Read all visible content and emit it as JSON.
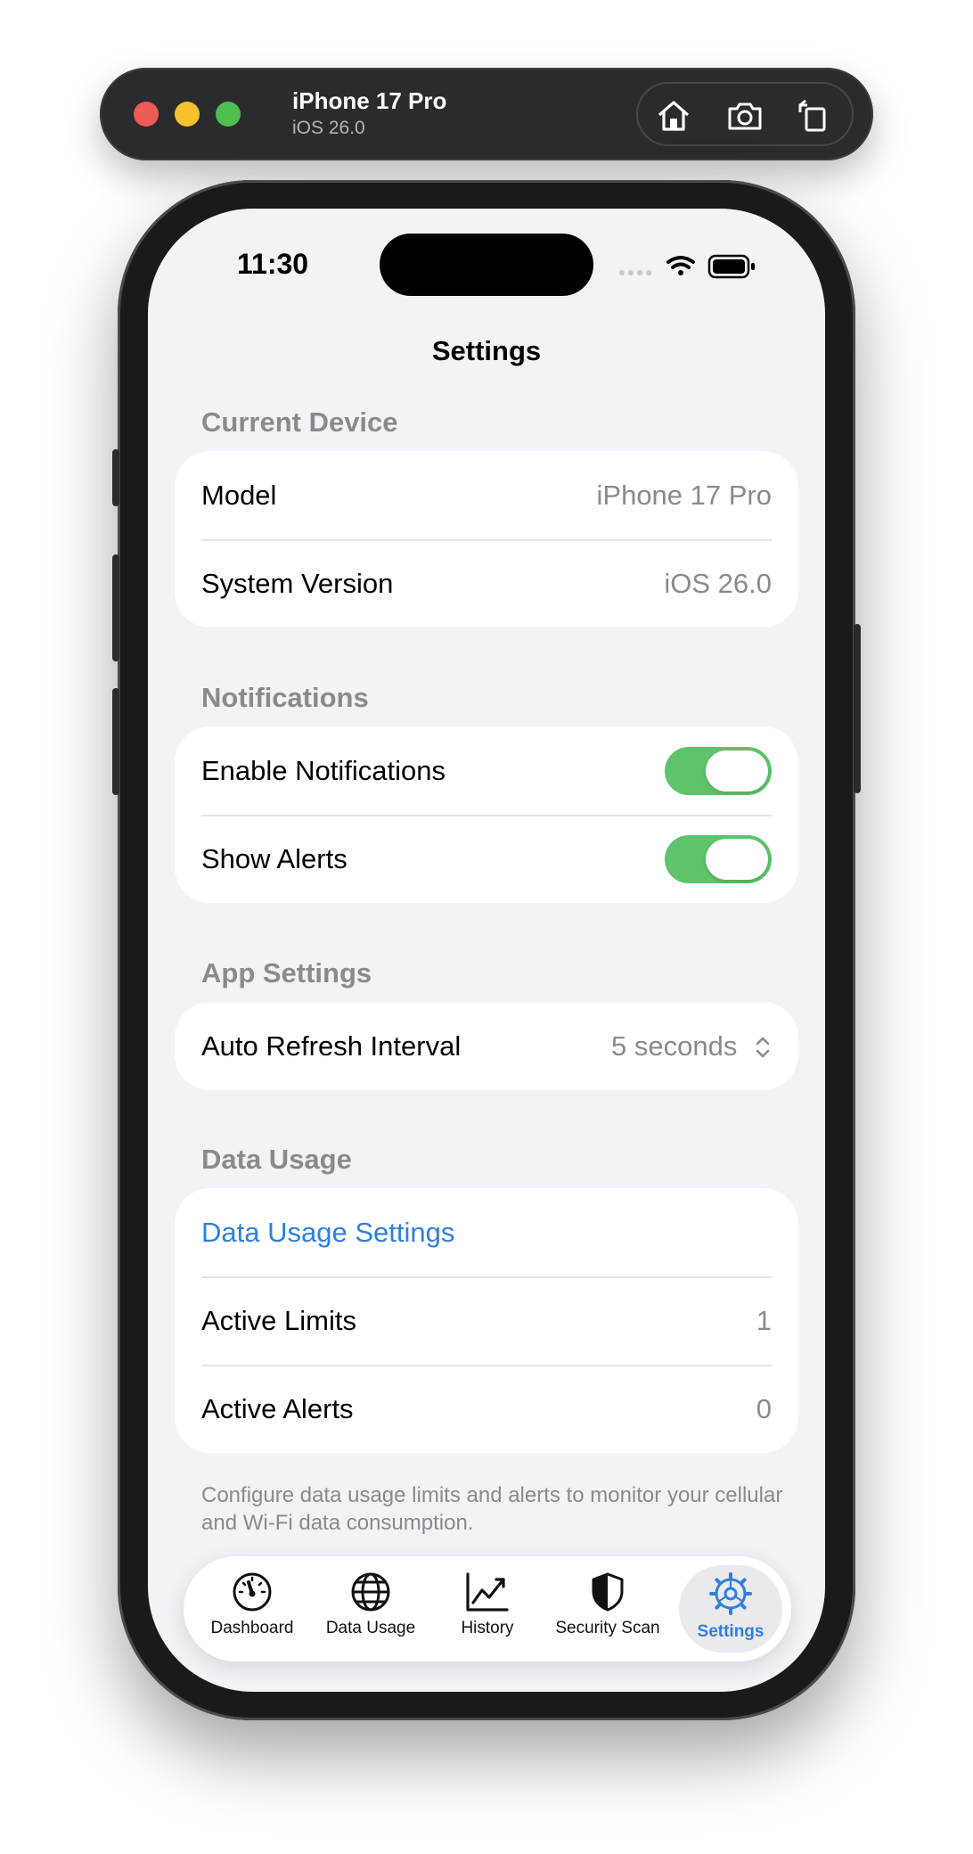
{
  "simulator": {
    "device_name": "iPhone 17 Pro",
    "os_version": "iOS 26.0",
    "tools": [
      "home-icon",
      "screenshot-icon",
      "rotate-icon"
    ]
  },
  "status_bar": {
    "time": "11:30",
    "icons": [
      "cellular-icon",
      "wifi-icon",
      "battery-icon"
    ]
  },
  "nav": {
    "title": "Settings"
  },
  "sections": {
    "current_device": {
      "header": "Current Device",
      "rows": [
        {
          "label": "Model",
          "value": "iPhone 17 Pro"
        },
        {
          "label": "System Version",
          "value": "iOS 26.0"
        }
      ]
    },
    "notifications": {
      "header": "Notifications",
      "rows": [
        {
          "label": "Enable Notifications",
          "on": true
        },
        {
          "label": "Show Alerts",
          "on": true
        }
      ]
    },
    "app_settings": {
      "header": "App Settings",
      "rows": [
        {
          "label": "Auto Refresh Interval",
          "value": "5 seconds"
        }
      ]
    },
    "data_usage": {
      "header": "Data Usage",
      "link": "Data Usage Settings",
      "rows": [
        {
          "label": "Active Limits",
          "value": "1"
        },
        {
          "label": "Active Alerts",
          "value": "0"
        }
      ],
      "footnote": "Configure data usage limits and alerts to monitor your cellular and Wi-Fi data consumption."
    }
  },
  "tabs": [
    {
      "label": "Dashboard",
      "icon": "gauge-icon",
      "active": false
    },
    {
      "label": "Data Usage",
      "icon": "globe-icon",
      "active": false
    },
    {
      "label": "History",
      "icon": "chart-line-icon",
      "active": false
    },
    {
      "label": "Security Scan",
      "icon": "shield-icon",
      "active": false
    },
    {
      "label": "Settings",
      "icon": "gear-icon",
      "active": true
    }
  ],
  "colors": {
    "accent": "#2e7fe0",
    "toggle_on": "#5ec36a",
    "background": "#f2f2f7",
    "secondary_text": "#8a8a8e"
  }
}
